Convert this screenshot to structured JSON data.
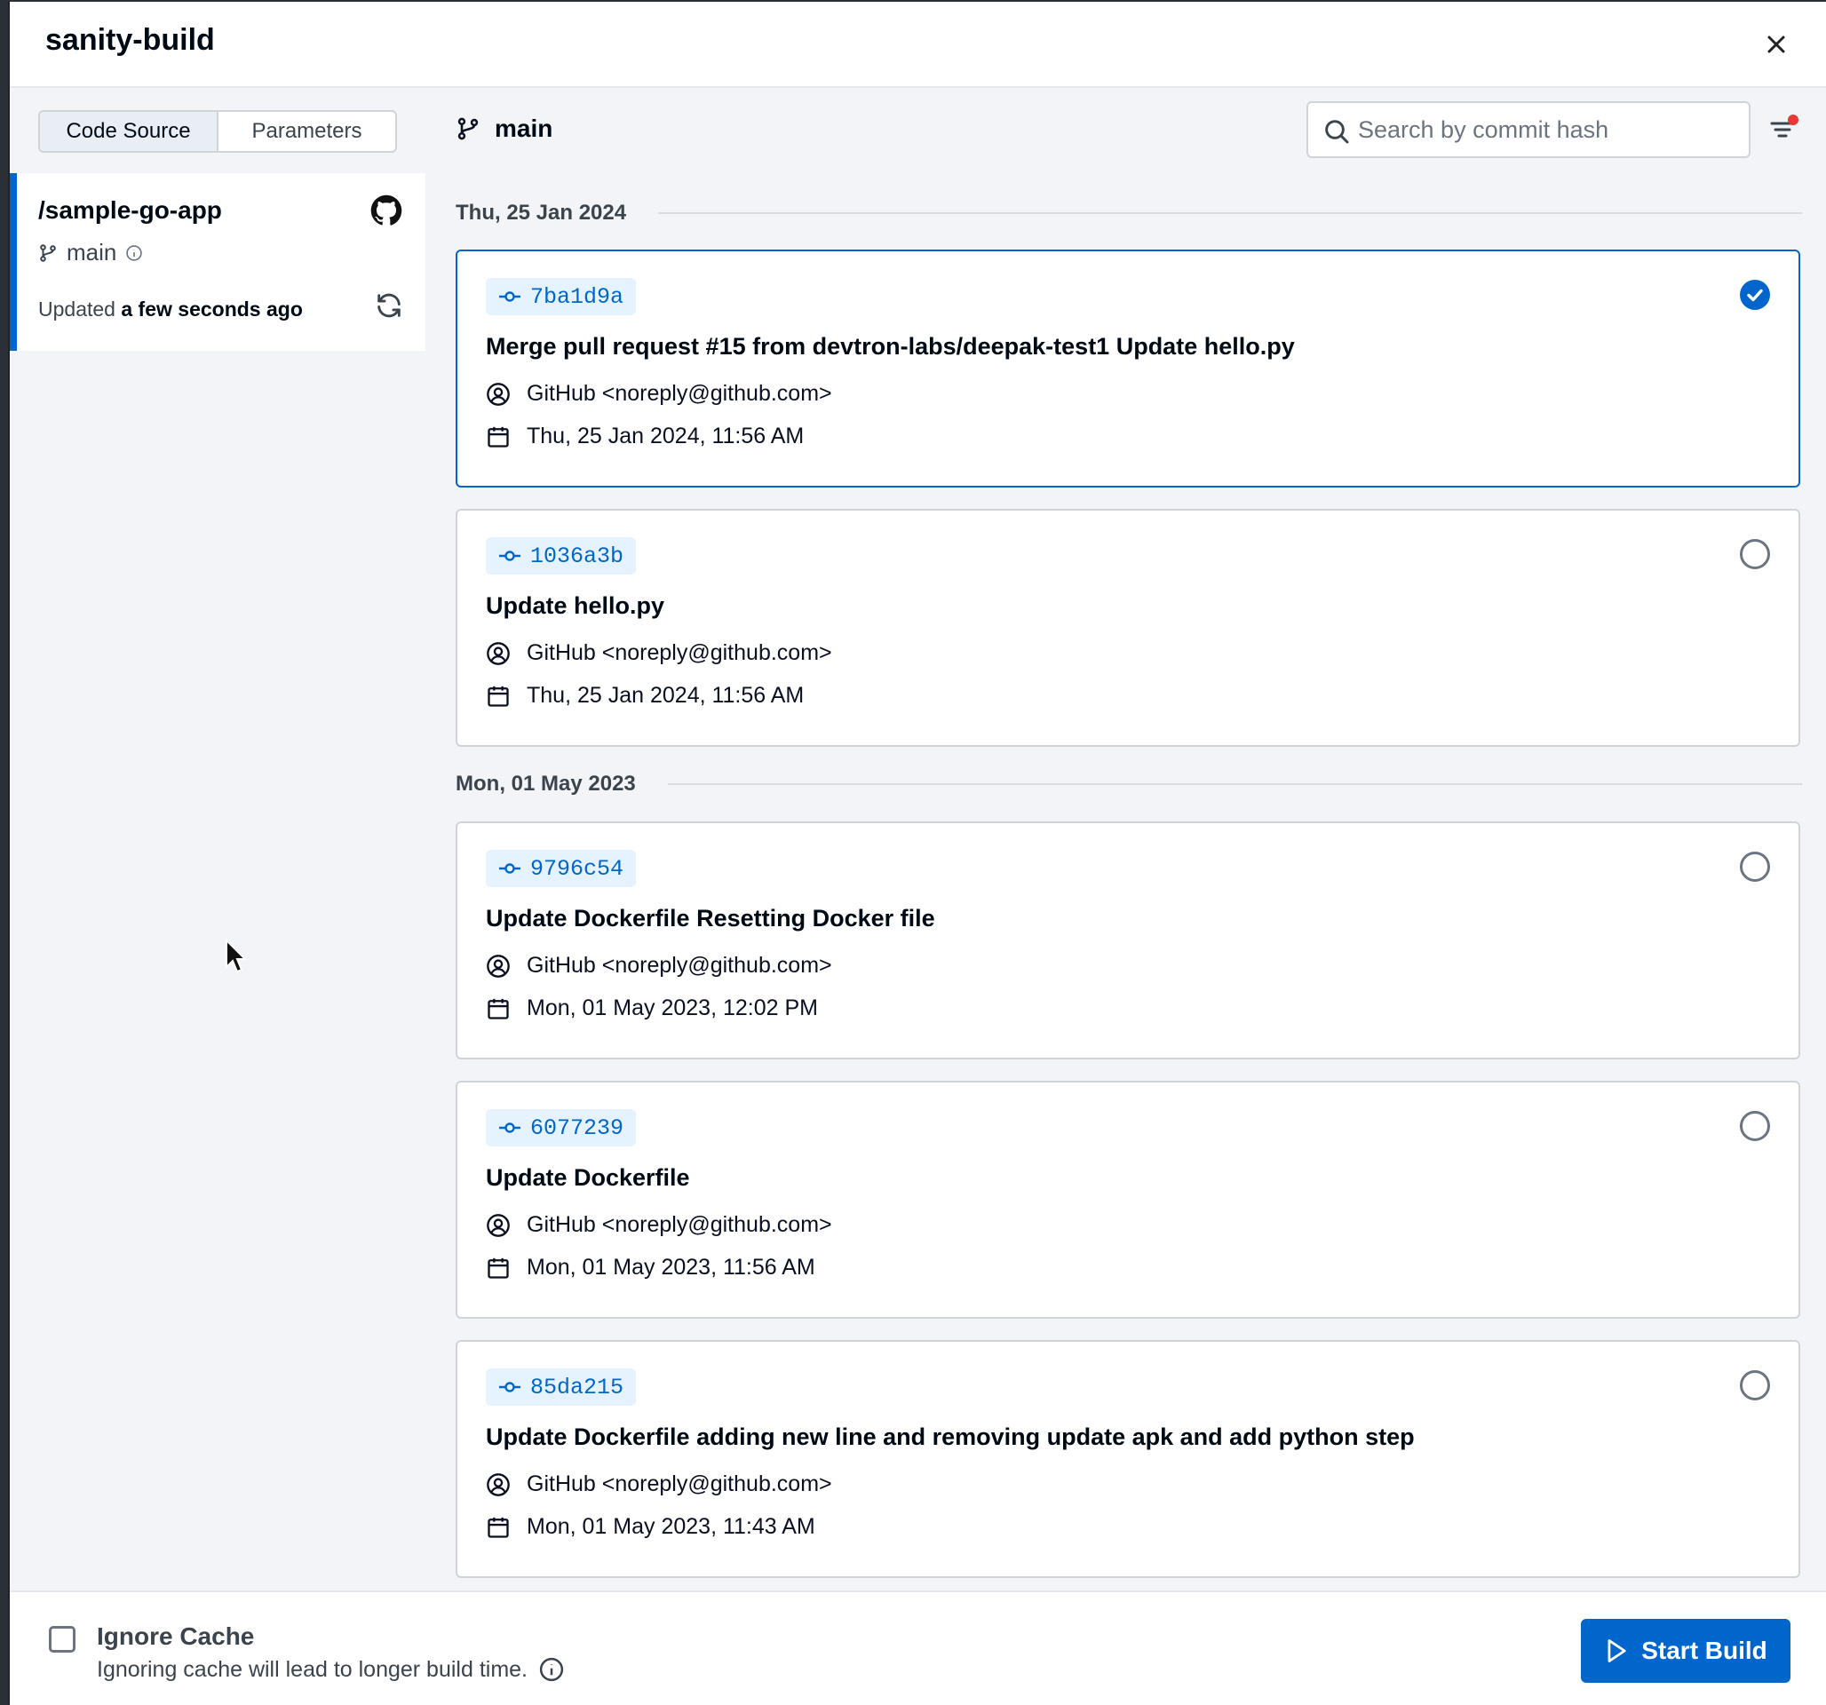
{
  "modal": {
    "title": "sanity-build"
  },
  "sidebar": {
    "tabs": [
      {
        "label": "Code Source",
        "active": true
      },
      {
        "label": "Parameters",
        "active": false
      }
    ],
    "repo": {
      "name": "/sample-go-app",
      "branch": "main",
      "updated_prefix": "Updated",
      "updated_value": "a few seconds ago",
      "icon": "github-icon"
    }
  },
  "main": {
    "branch": "main",
    "search": {
      "placeholder": "Search by commit hash",
      "value": ""
    },
    "groups": [
      {
        "date": "Thu, 25 Jan 2024",
        "commits": [
          {
            "hash": "7ba1d9a",
            "message": "Merge pull request #15 from devtron-labs/deepak-test1 Update hello.py",
            "author": "GitHub <noreply@github.com>",
            "date": "Thu, 25 Jan 2024, 11:56 AM",
            "selected": true
          },
          {
            "hash": "1036a3b",
            "message": "Update hello.py",
            "author": "GitHub <noreply@github.com>",
            "date": "Thu, 25 Jan 2024, 11:56 AM",
            "selected": false
          }
        ]
      },
      {
        "date": "Mon, 01 May 2023",
        "commits": [
          {
            "hash": "9796c54",
            "message": "Update Dockerfile Resetting Docker file",
            "author": "GitHub <noreply@github.com>",
            "date": "Mon, 01 May 2023, 12:02 PM",
            "selected": false
          },
          {
            "hash": "6077239",
            "message": "Update Dockerfile",
            "author": "GitHub <noreply@github.com>",
            "date": "Mon, 01 May 2023, 11:56 AM",
            "selected": false
          },
          {
            "hash": "85da215",
            "message": "Update Dockerfile adding new line and removing update apk and add python step",
            "author": "GitHub <noreply@github.com>",
            "date": "Mon, 01 May 2023, 11:43 AM",
            "selected": false
          }
        ]
      }
    ]
  },
  "footer": {
    "ignore_cache_label": "Ignore Cache",
    "ignore_cache_checked": false,
    "ignore_cache_note": "Ignoring cache will lead to longer build time.",
    "start_build_label": "Start Build"
  },
  "colors": {
    "accent": "#0066cc",
    "hash_bg": "#e5f2ff",
    "panel_bg": "#f2f4f7",
    "notification_dot": "#e53935"
  }
}
